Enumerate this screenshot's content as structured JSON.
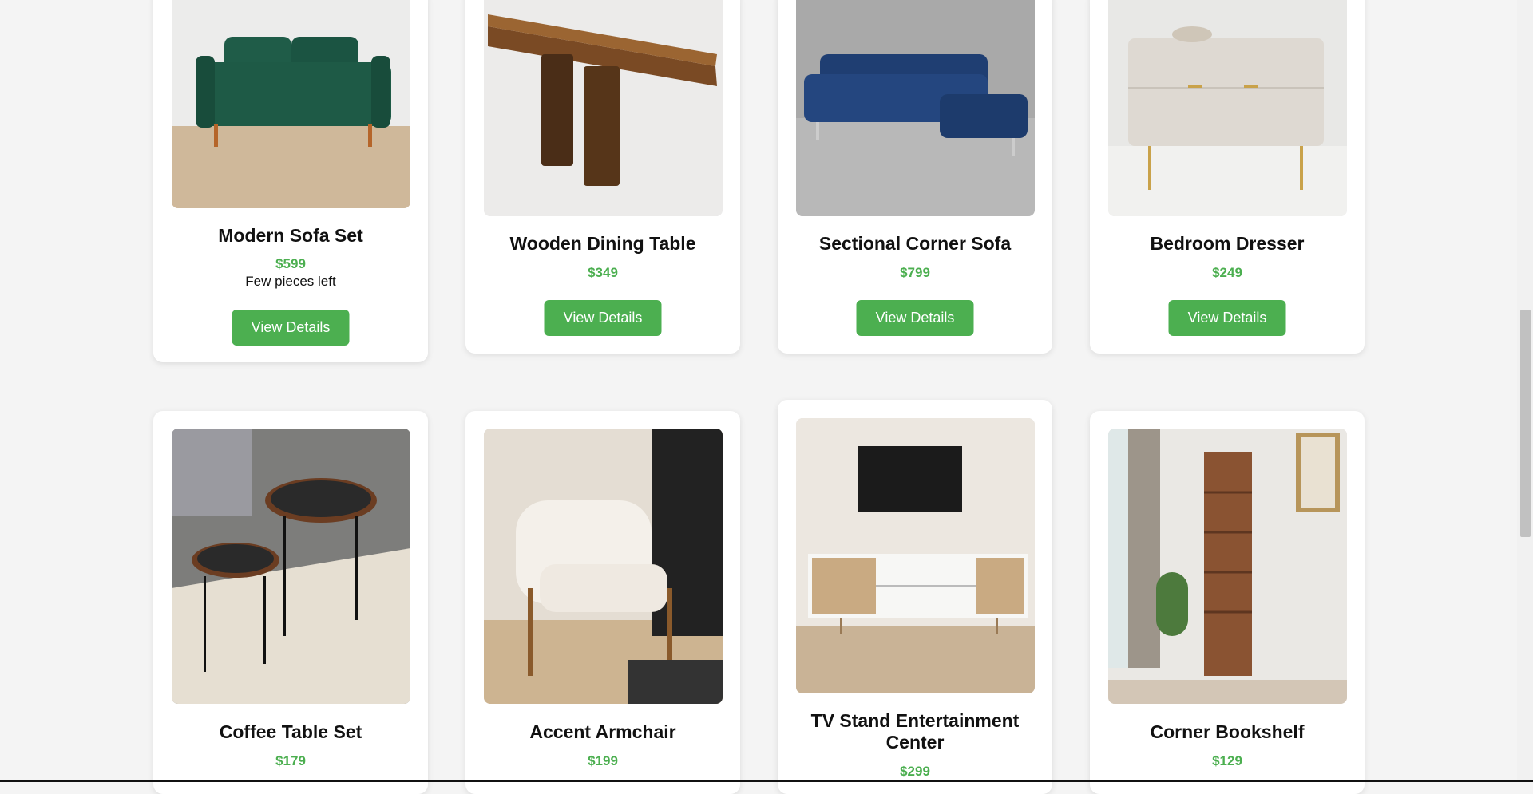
{
  "products": [
    {
      "name": "Modern Sofa Set",
      "price": "$599",
      "stock": "Few pieces left",
      "button": "View Details"
    },
    {
      "name": "Wooden Dining Table",
      "price": "$349",
      "button": "View Details"
    },
    {
      "name": "Sectional Corner Sofa",
      "price": "$799",
      "button": "View Details"
    },
    {
      "name": "Bedroom Dresser",
      "price": "$249",
      "button": "View Details"
    },
    {
      "name": "Coffee Table Set",
      "price": "$179"
    },
    {
      "name": "Accent Armchair",
      "price": "$199"
    },
    {
      "name": "TV Stand Entertainment Center",
      "price": "$299"
    },
    {
      "name": "Corner Bookshelf",
      "price": "$129"
    }
  ],
  "colors": {
    "accent": "#4caf50",
    "background": "#f4f4f4",
    "card": "#ffffff"
  }
}
